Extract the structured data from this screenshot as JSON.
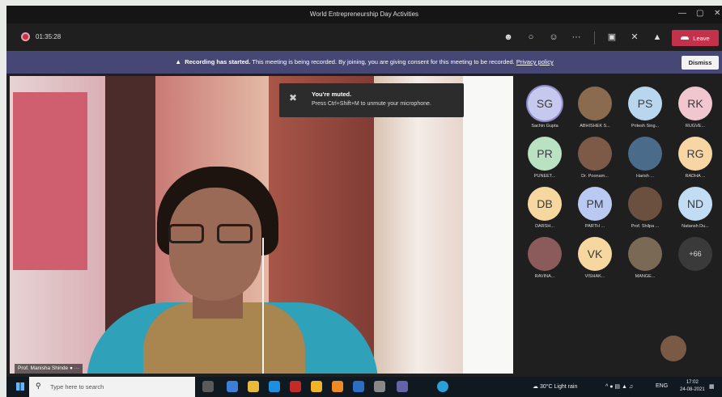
{
  "window": {
    "title": "World Entrepreneurship Day Activities"
  },
  "toolbar": {
    "timer": "01:35:28",
    "leave_label": "Leave",
    "icons": [
      "participants-icon",
      "chat-icon",
      "reactions-icon",
      "more-icon",
      "camera-off-icon",
      "mic-off-icon",
      "share-icon"
    ]
  },
  "banner": {
    "bold": "Recording has started.",
    "text": " This meeting is being recorded. By joining, you are giving consent for this meeting to be recorded.",
    "link": "Privacy policy",
    "dismiss_label": "Dismiss"
  },
  "toast": {
    "title": "You're muted.",
    "body": "Press Ctrl+Shift+M to unmute your microphone."
  },
  "main_video": {
    "speaker": "Prof. Manisha Shinde"
  },
  "participants": [
    {
      "initials": "SG",
      "name": "Sachin Gupta",
      "color": "#c7c8ee"
    },
    {
      "initials": "",
      "name": "ABHISHEK S...",
      "color": "#8a6b50"
    },
    {
      "initials": "PS",
      "name": "Pritesh Sing...",
      "color": "#b9d6ef"
    },
    {
      "initials": "RK",
      "name": "RUGVE...",
      "color": "#f1c6cf"
    },
    {
      "initials": "PR",
      "name": "PUNEET...",
      "color": "#b8e2c2"
    },
    {
      "initials": "",
      "name": "Dr. Poonam...",
      "color": "#7d5a48"
    },
    {
      "initials": "",
      "name": "Harish ...",
      "color": "#4a6b8a"
    },
    {
      "initials": "RG",
      "name": "RADHA ...",
      "color": "#f7d6a4"
    },
    {
      "initials": "DB",
      "name": "DARSH...",
      "color": "#f6d79f"
    },
    {
      "initials": "PM",
      "name": "PARTH ...",
      "color": "#b9c9f1"
    },
    {
      "initials": "",
      "name": "Prof. Shilpa ...",
      "color": "#6b5040"
    },
    {
      "initials": "ND",
      "name": "Natansh Du...",
      "color": "#c2dcf3"
    },
    {
      "initials": "",
      "name": "RAVINA...",
      "color": "#8b5a5a"
    },
    {
      "initials": "VK",
      "name": "VISHAK...",
      "color": "#f6d79f"
    },
    {
      "initials": "",
      "name": "MANGE...",
      "color": "#7a6a55"
    },
    {
      "initials": "+66",
      "name": "",
      "color": "#3a3a3a"
    }
  ],
  "taskbar": {
    "search_placeholder": "Type here to search",
    "weather": "30°C  Light rain",
    "lang": "ENG",
    "time": "17:02",
    "date": "24-08-2021"
  }
}
